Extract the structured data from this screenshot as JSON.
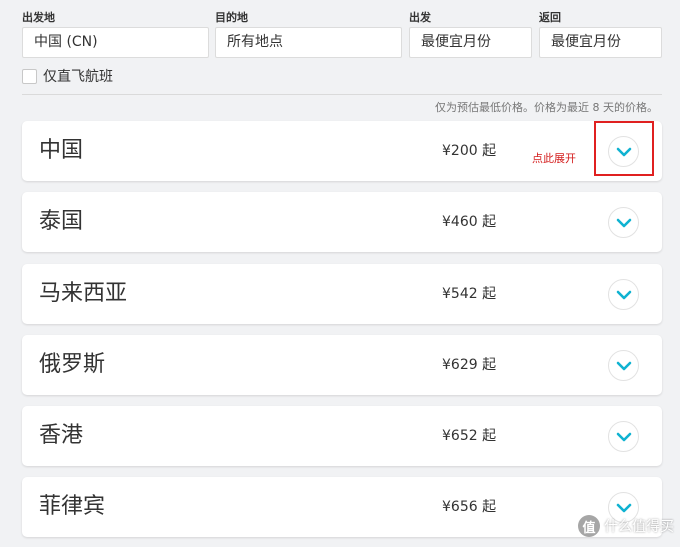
{
  "filters": {
    "origin": {
      "label": "出发地",
      "value": "中国 (CN)"
    },
    "destination": {
      "label": "目的地",
      "value": "所有地点"
    },
    "depart": {
      "label": "出发",
      "value": "最便宜月份"
    },
    "return": {
      "label": "返回",
      "value": "最便宜月份"
    }
  },
  "direct_only": {
    "label": "仅直飞航班",
    "checked": false
  },
  "price_note": "仅为预估最低价格。价格为最近 8 天的价格。",
  "destinations": [
    {
      "name": "中国",
      "price": "¥200 起"
    },
    {
      "name": "泰国",
      "price": "¥460 起"
    },
    {
      "name": "马来西亚",
      "price": "¥542 起"
    },
    {
      "name": "俄罗斯",
      "price": "¥629 起"
    },
    {
      "name": "香港",
      "price": "¥652 起"
    },
    {
      "name": "菲律宾",
      "price": "¥656 起"
    }
  ],
  "annotation": {
    "text": "点此展开",
    "color": "#d41c1c"
  },
  "watermark": {
    "logo": "值",
    "text": "什么值得买"
  },
  "colors": {
    "accent": "#0fb2d1",
    "annotation_box": "#e02020"
  }
}
